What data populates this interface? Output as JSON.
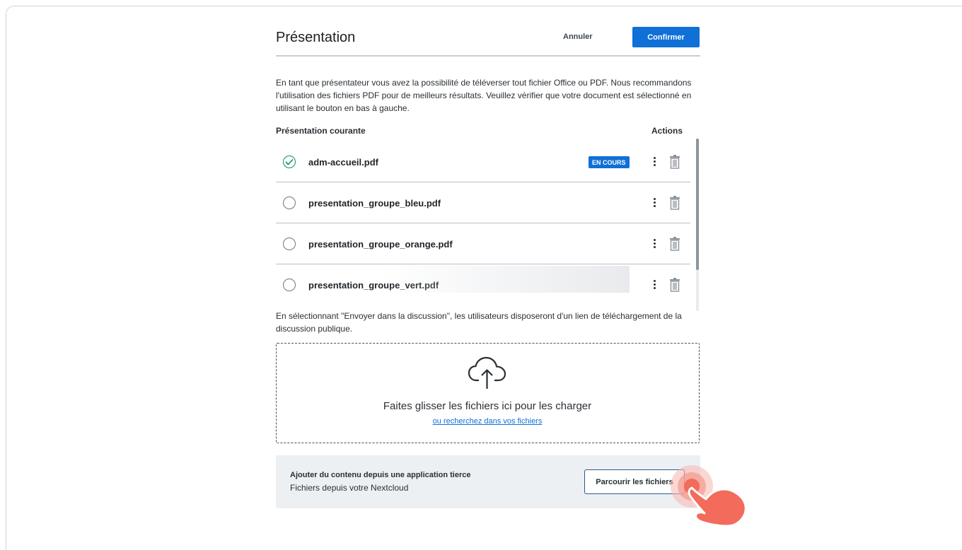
{
  "header": {
    "title": "Présentation",
    "cancel_label": "Annuler",
    "confirm_label": "Confirmer"
  },
  "intro": "En tant que présentateur vous avez la possibilité de téléverser tout fichier Office ou PDF. Nous recommandons l'utilisation des fichiers PDF pour de meilleurs résultats. Veuillez vérifier que votre document est sélectionné en utilisant le bouton en bas à gauche.",
  "list": {
    "header_left": "Présentation courante",
    "header_right": "Actions",
    "files": [
      {
        "name": "adm-accueil.pdf",
        "selected": true,
        "badge": "EN COURS"
      },
      {
        "name": "presentation_groupe_bleu.pdf",
        "selected": false
      },
      {
        "name": "presentation_groupe_orange.pdf",
        "selected": false
      },
      {
        "name": "presentation_groupe_vert.pdf",
        "selected": false
      }
    ]
  },
  "discussion_note": "En sélectionnant \"Envoyer dans la discussion\", les utilisateurs disposeront d'un lien de téléchargement de la discussion publique.",
  "dropzone": {
    "text": "Faites glisser les fichiers ici pour les charger",
    "link": "ou recherchez dans vos fichiers"
  },
  "third_party": {
    "title": "Ajouter du contenu depuis une application tierce",
    "subtitle": "Fichiers depuis votre Nextcloud",
    "button_label": "Parcourir les fichiers"
  },
  "colors": {
    "primary": "#0f70d7",
    "selected_check": "#0a8f6a",
    "panel_bg": "#edf0f3",
    "hand": "#f26b5b"
  }
}
